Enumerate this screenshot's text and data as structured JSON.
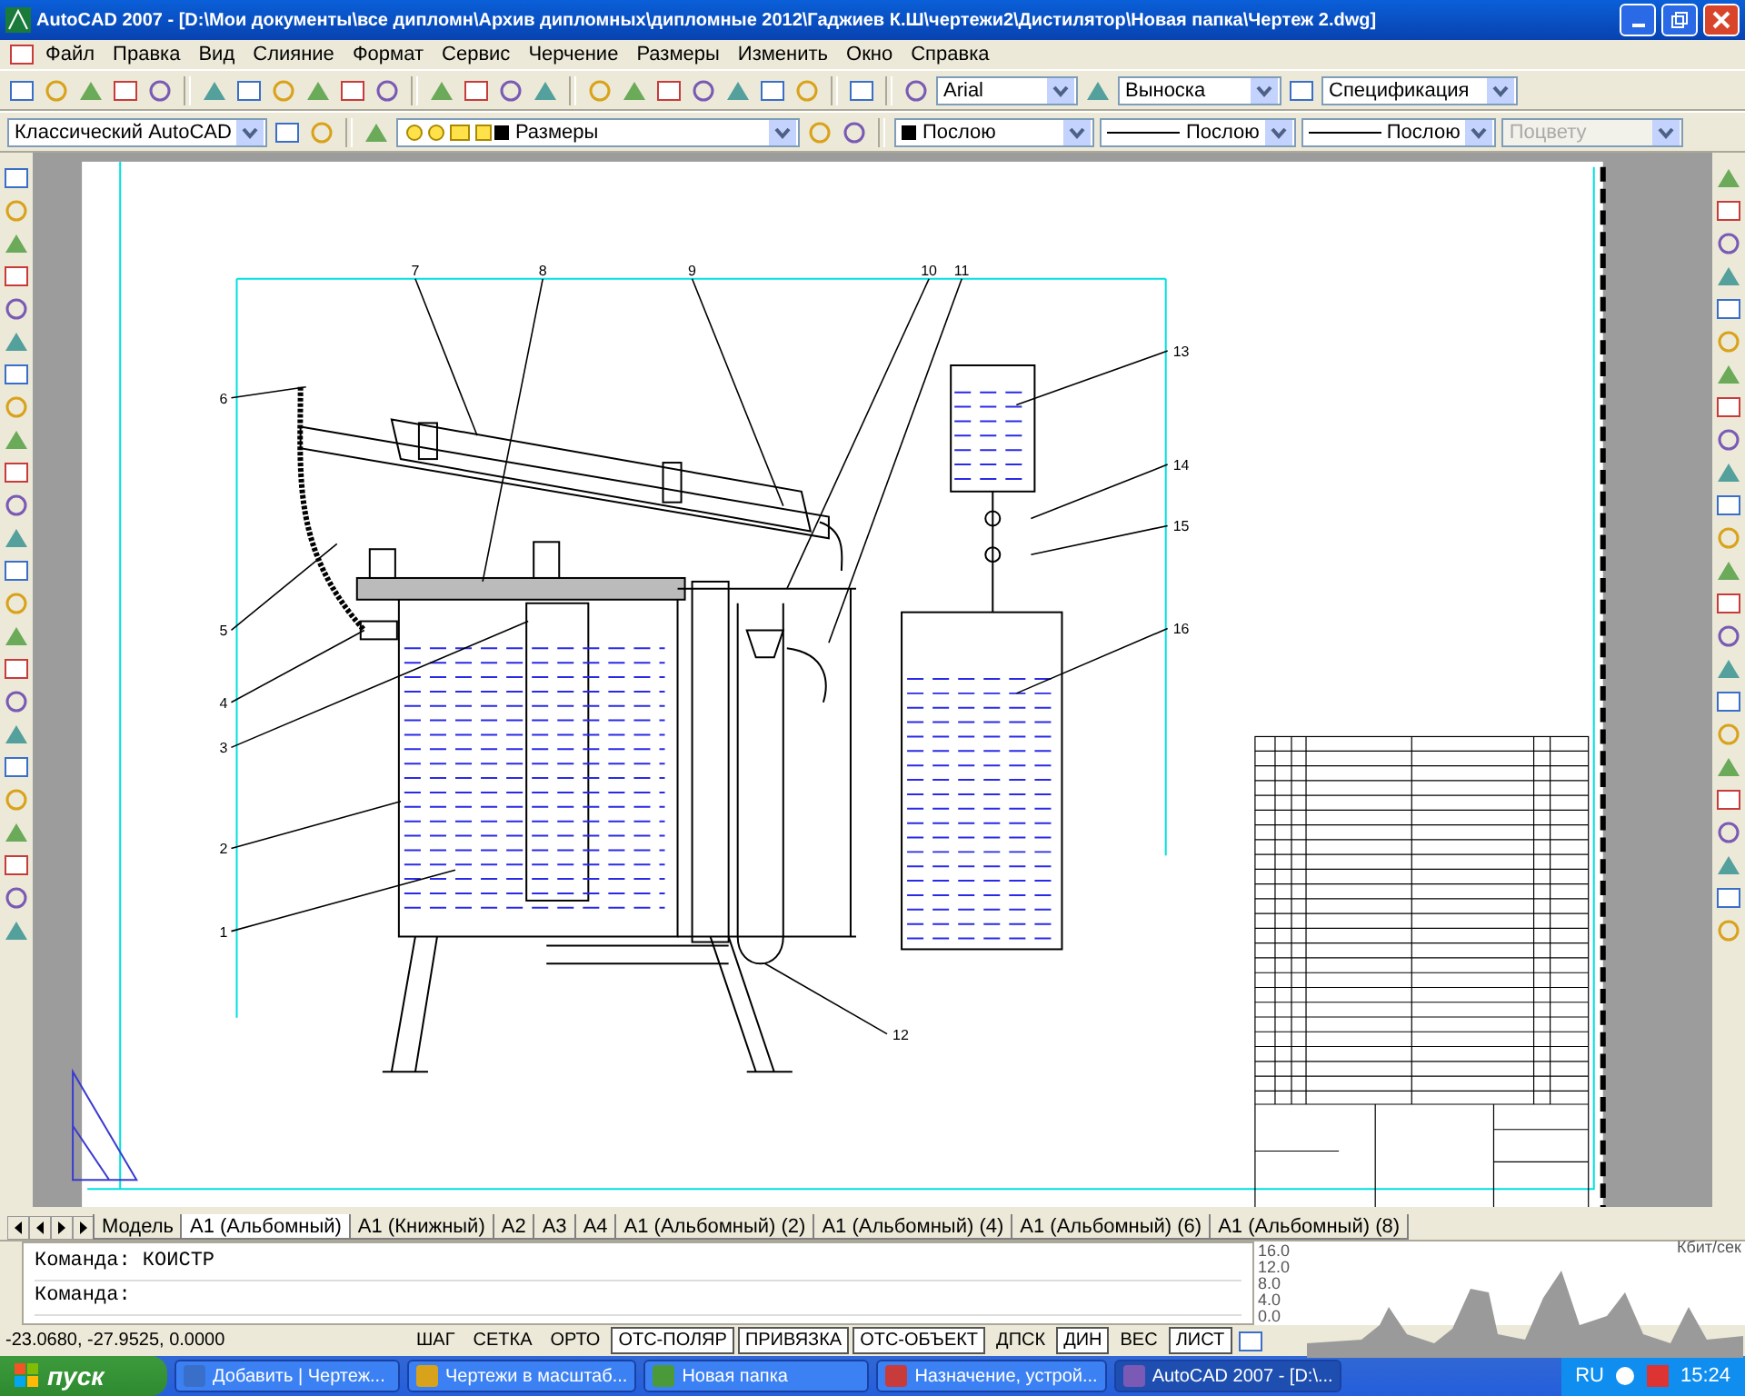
{
  "window": {
    "title": "AutoCAD 2007 - [D:\\Мои документы\\все дипломн\\Архив дипломных\\дипломные 2012\\Гаджиев К.Ш\\чертежи2\\Дистилятор\\Новая папка\\Чертеж 2.dwg]"
  },
  "menu": [
    "Файл",
    "Правка",
    "Вид",
    "Слияние",
    "Формат",
    "Сервис",
    "Черчение",
    "Размеры",
    "Изменить",
    "Окно",
    "Справка"
  ],
  "toolbar_1": {
    "dropdowns": [
      {
        "value": "Arial",
        "disabled": false
      },
      {
        "value": "Выноска",
        "disabled": false
      },
      {
        "value": "Спецификация",
        "disabled": false
      }
    ]
  },
  "toolbar_2": {
    "dropdowns": [
      {
        "kind": "workspace",
        "value": "Классический AutoCAD",
        "disabled": false
      },
      {
        "kind": "layer",
        "value": "Размеры",
        "disabled": false
      },
      {
        "kind": "color",
        "value": "Послою",
        "disabled": false
      },
      {
        "kind": "line",
        "value": "Послою",
        "disabled": false
      },
      {
        "kind": "line",
        "value": "Послою",
        "disabled": false
      },
      {
        "kind": "plain",
        "value": "Поцвету",
        "disabled": true
      }
    ]
  },
  "drawing": {
    "callouts": [
      "7",
      "8",
      "9",
      "10",
      "11",
      "13",
      "6",
      "14",
      "15",
      "5",
      "16",
      "4",
      "3",
      "2",
      "1",
      "12"
    ]
  },
  "layout_tabs": [
    {
      "label": "Модель",
      "selected": false
    },
    {
      "label": "A1 (Альбомный)",
      "selected": true
    },
    {
      "label": "A1 (Книжный)",
      "selected": false
    },
    {
      "label": "A2",
      "selected": false
    },
    {
      "label": "A3",
      "selected": false
    },
    {
      "label": "A4",
      "selected": false
    },
    {
      "label": "A1 (Альбомный) (2)",
      "selected": false
    },
    {
      "label": "A1 (Альбомный) (4)",
      "selected": false
    },
    {
      "label": "A1 (Альбомный) (6)",
      "selected": false
    },
    {
      "label": "A1 (Альбомный) (8)",
      "selected": false
    }
  ],
  "command_lines": [
    "Команда:  КОИСТР",
    "Команда:"
  ],
  "traffic_graph": {
    "unit": "Кбит/сек",
    "ticks": [
      "16.0",
      "12.0",
      "8.0",
      "4.0",
      "0.0"
    ]
  },
  "status_bar": {
    "coordinates": "-23.0680, -27.9525, 0.0000",
    "toggles": [
      {
        "label": "ШАГ",
        "on": false
      },
      {
        "label": "СЕТКА",
        "on": false
      },
      {
        "label": "ОРТО",
        "on": false
      },
      {
        "label": "ОТС-ПОЛЯР",
        "on": true
      },
      {
        "label": "ПРИВЯЗКА",
        "on": true
      },
      {
        "label": "ОТС-ОБЪЕКТ",
        "on": true
      },
      {
        "label": "ДПСК",
        "on": false
      },
      {
        "label": "ДИН",
        "on": true
      },
      {
        "label": "ВЕС",
        "on": false
      },
      {
        "label": "ЛИСТ",
        "on": true
      }
    ]
  },
  "taskbar": {
    "start": "пуск",
    "tasks": [
      {
        "label": "Добавить | Чертеж...",
        "selected": false
      },
      {
        "label": "Чертежи в масштаб...",
        "selected": false
      },
      {
        "label": "Новая папка",
        "selected": false
      },
      {
        "label": "Назначение, устрой...",
        "selected": false
      },
      {
        "label": "AutoCAD 2007 - [D:\\...",
        "selected": true
      }
    ],
    "language": "RU",
    "clock": "15:24"
  }
}
